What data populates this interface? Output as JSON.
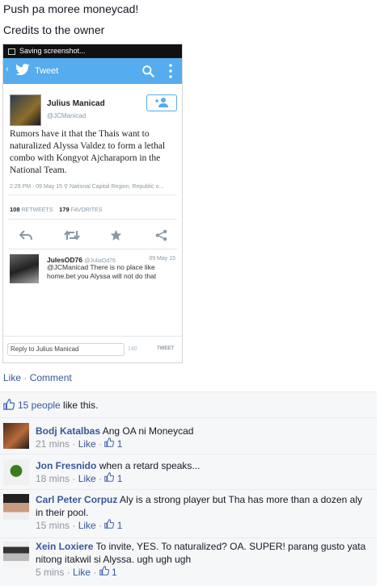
{
  "post": {
    "line1": "Push pa moree moneycad!",
    "line2": "Credits to the owner"
  },
  "screenshot": {
    "status_text": "Saving screenshot...",
    "toolbar_title": "Tweet",
    "author_name": "Julius Manicad",
    "author_handle": "@JCManicad",
    "tweet_text": "Rumors have it that the Thais want to naturalized Alyssa Valdez to form a lethal combo with Kongyot Ajcharaporn in the National Team.",
    "meta": "2:29 PM · 09 May 15  ⚲ National Capital Region, Republic o...",
    "retweets_count": "108",
    "retweets_label": "RETWEETS",
    "favorites_count": "179",
    "favorites_label": "FAVORITES",
    "reply": {
      "name": "JulesOD76",
      "handle": "@JuliaOd76",
      "date": "09 May 15",
      "text": "@JCManicad There is no place like home.bet you Alyssa will not do that"
    },
    "reply_placeholder": "Reply to Julius Manicad",
    "char_count": "140",
    "tweet_button": "TWEET"
  },
  "actions": {
    "like": "Like",
    "separator": "·",
    "comment": "Comment"
  },
  "likes": {
    "people": "15 people",
    "suffix": " like this."
  },
  "comments": [
    {
      "name": "Bodj Katalbas",
      "text": "Ang OA ni Moneycad",
      "time": "21 mins",
      "like": "Like",
      "count": "1"
    },
    {
      "name": "Jon Fresnido",
      "text": "when a retard speaks...",
      "time": "18 mins",
      "like": "Like",
      "count": "1"
    },
    {
      "name": "Carl Peter Corpuz",
      "text": "Aly is a strong player but Tha has more than a dozen aly in their pool.",
      "time": "15 mins",
      "like": "Like",
      "count": "1"
    },
    {
      "name": "Xein Loxiere",
      "text": "To invite, YES. To naturalized? OA. SUPER! parang gusto yata nitong itakwil si Alyssa. ugh ugh ugh",
      "time": "5 mins",
      "like": "Like",
      "count": "1"
    }
  ],
  "colors": {
    "link": "#365899",
    "twitter_blue": "#55acee",
    "muted": "#90949c"
  }
}
